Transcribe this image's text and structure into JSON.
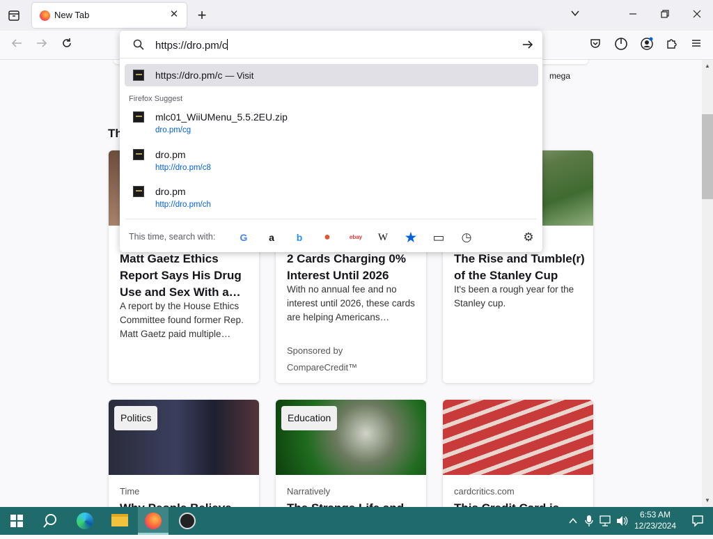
{
  "browser": {
    "tab": {
      "title": "New Tab"
    },
    "new_tab": "+",
    "window": {
      "list_all_tabs": "⌄",
      "minimize": "—",
      "restore": "❐",
      "close": "✕"
    }
  },
  "urlbar": {
    "value": "https://dro.pm/c",
    "go": "→",
    "heuristic": {
      "url": "https://dro.pm/c",
      "action": "— Visit"
    },
    "group_label": "Firefox Suggest",
    "suggestions": [
      {
        "title": "mlc01_WiiUMenu_5.5.2EU.zip",
        "url": "dro.pm/cg"
      },
      {
        "title": "dro.pm",
        "url": "http://dro.pm/c8"
      },
      {
        "title": "dro.pm",
        "url": "http://dro.pm/ch"
      }
    ],
    "search_with_label": "This time, search with:",
    "engines": [
      {
        "name": "google-icon",
        "glyph": "G",
        "color": "#4285f4"
      },
      {
        "name": "amazon-icon",
        "glyph": "a",
        "color": "#111111"
      },
      {
        "name": "bing-icon",
        "glyph": "b",
        "color": "#258ffa"
      },
      {
        "name": "duckduckgo-icon",
        "glyph": "●",
        "color": "#de5833"
      },
      {
        "name": "ebay-icon",
        "glyph": "ebay",
        "color": "#e53238"
      },
      {
        "name": "wikipedia-icon",
        "glyph": "W",
        "color": "#111111"
      },
      {
        "name": "bookmarks-icon",
        "glyph": "★",
        "color": "#0060df"
      },
      {
        "name": "tabs-icon",
        "glyph": "▭",
        "color": "#333333"
      },
      {
        "name": "history-icon",
        "glyph": "◷",
        "color": "#333333"
      }
    ]
  },
  "newtab": {
    "shortcut_label": "mega",
    "section_heading": "Th",
    "cards": [
      {
        "headline": "Matt Gaetz Ethics Report Says His Drug Use and Sex With a…",
        "desc": "A report by the House Ethics Committee found former Rep. Matt Gaetz paid multiple…",
        "src": ""
      },
      {
        "headline": "2 Cards Charging 0% Interest Until 2026",
        "desc": "With no annual fee and no interest until 2026, these cards are helping Americans…",
        "src": "Sponsored by",
        "src2": "CompareCredit™"
      },
      {
        "headline": "The Rise and Tumble(r) of the Stanley Cup",
        "desc": "It's been a rough year for the Stanley cup.",
        "src": ""
      }
    ],
    "cards2": [
      {
        "badge": "Politics",
        "src": "Time",
        "headline": "Why People Believe"
      },
      {
        "badge": "Education",
        "src": "Narratively",
        "headline": "The Strange Life and"
      },
      {
        "badge": "",
        "src": "cardcritics.com",
        "headline": "This Credit Card is"
      }
    ]
  },
  "taskbar": {
    "time": "6:53 AM",
    "date": "12/23/2024"
  }
}
